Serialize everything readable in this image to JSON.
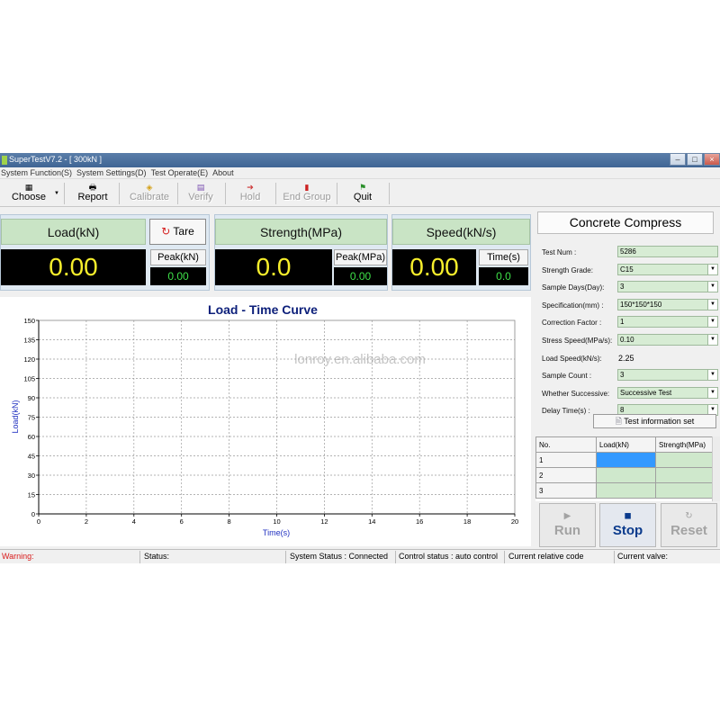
{
  "window": {
    "title": "SuperTestV7.2 - [ 300kN ]"
  },
  "menu": [
    "System Function(S)",
    "System Settings(D)",
    "Test Operate(E)",
    "About"
  ],
  "toolbar": {
    "choose": "Choose",
    "report": "Report",
    "calibrate": "Calibrate",
    "verify": "Verify",
    "hold": "Hold",
    "end_group": "End Group",
    "quit": "Quit"
  },
  "load": {
    "header": "Load(kN)",
    "value": "0.00",
    "tare_label": "Tare",
    "peak_label": "Peak(kN)",
    "peak_value": "0.00"
  },
  "strength": {
    "header": "Strength(MPa)",
    "value": "0.0",
    "peak_label": "Peak(MPa)",
    "peak_value": "0.00"
  },
  "speed": {
    "header": "Speed(kN/s)",
    "value": "0.00",
    "time_label": "Time(s)",
    "time_value": "0.0"
  },
  "chart_data": {
    "type": "line",
    "title": "Load - Time Curve",
    "xlabel": "Time(s)",
    "ylabel": "Load(kN)",
    "xlim": [
      0,
      20
    ],
    "ylim": [
      0,
      150
    ],
    "xticks": [
      0,
      2,
      4,
      6,
      8,
      10,
      12,
      14,
      16,
      18,
      20
    ],
    "yticks": [
      0,
      15,
      30,
      45,
      60,
      75,
      90,
      105,
      120,
      135,
      150
    ],
    "grid": true,
    "series": [],
    "watermark": "lonroy.en.alibaba.com"
  },
  "right_panel": {
    "title": "Concrete Compress",
    "fields": [
      {
        "label": "Test Num :",
        "value": "5286",
        "kind": "input"
      },
      {
        "label": "Strength Grade:",
        "value": "C15",
        "kind": "select"
      },
      {
        "label": "Sample Days(Day):",
        "value": "3",
        "kind": "select"
      },
      {
        "label": "Specification(mm) :",
        "value": "150*150*150",
        "kind": "select"
      },
      {
        "label": "Correction Factor :",
        "value": "1",
        "kind": "select"
      },
      {
        "label": "Stress Speed(MPa/s):",
        "value": "0.10",
        "kind": "select"
      },
      {
        "label": "Load Speed(kN/s):",
        "value": "2.25",
        "kind": "text"
      },
      {
        "label": "Sample Count :",
        "value": "3",
        "kind": "select"
      },
      {
        "label": "Whether Successive:",
        "value": "Successive Test",
        "kind": "select"
      },
      {
        "label": "Delay Time(s) :",
        "value": "8",
        "kind": "select"
      }
    ],
    "test_info_button": "Test information set"
  },
  "results_table": {
    "headers": [
      "No.",
      "Load(kN)",
      "Strength(MPa)"
    ],
    "rows": [
      [
        "1",
        "",
        ""
      ],
      [
        "2",
        "",
        ""
      ],
      [
        "3",
        "",
        ""
      ]
    ]
  },
  "actions": {
    "run": "Run",
    "stop": "Stop",
    "reset": "Reset"
  },
  "status_bar": {
    "warning": "Warning:",
    "status": "Status:",
    "system_status": "System Status : Connected",
    "control_status": "Control status : auto control",
    "relative_code": "Current relative code",
    "valve": "Current valve:"
  },
  "colors": {
    "title_bar": "#4a6f9c",
    "header_green": "#c9e4c5",
    "readout_yellow": "#f7ef2c",
    "readout_green": "#3ee048",
    "stop_blue": "#0a3a8c",
    "warning_red": "#d81b1b"
  }
}
